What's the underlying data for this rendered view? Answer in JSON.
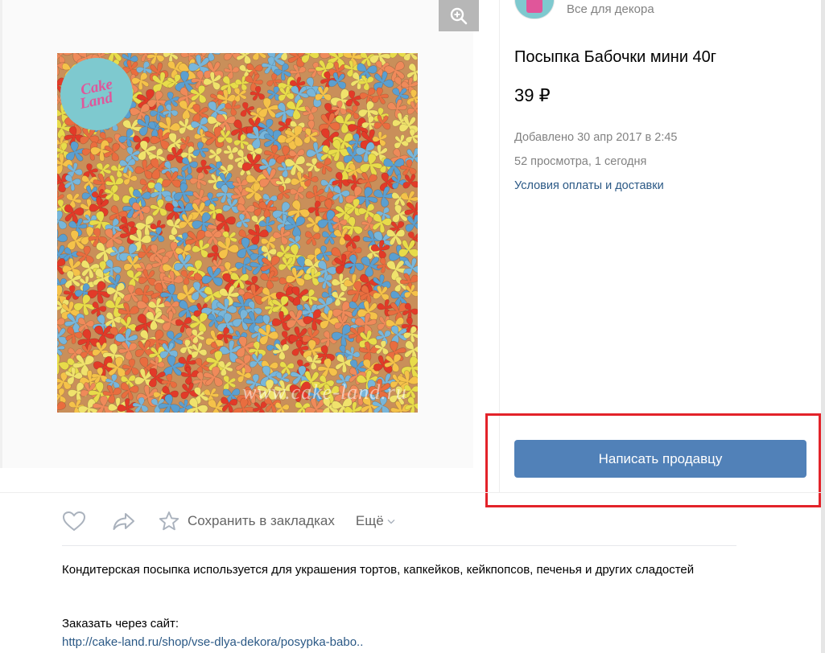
{
  "shop": {
    "name": "Все для декора",
    "avatar_icon": "cake-land-logo"
  },
  "product": {
    "title": "Посыпка Бабочки мини 40г",
    "price": "39 ₽",
    "added": "Добавлено 30 апр 2017 в 2:45",
    "views": "52 просмотра, 1 сегодня",
    "delivery_link": "Условия оплаты и доставки",
    "image": {
      "logo_line1": "Cake",
      "logo_line2": "Land",
      "watermark": "www.cake-land.ru",
      "colors": [
        "#e8dc4a",
        "#f0e26c",
        "#e23a28",
        "#ef8a5a",
        "#5b9fd0",
        "#78b6da",
        "#f5c24a",
        "#e96d3f"
      ]
    }
  },
  "contact_button": {
    "label": "Написать продавцу",
    "color": "#5181b8"
  },
  "highlight": {
    "color": "#e3232a"
  },
  "actions": {
    "like_icon": "heart-icon",
    "share_icon": "share-arrow-icon",
    "bookmark_icon": "star-icon",
    "bookmark_label": "Сохранить в закладках",
    "more_label": "Ещё"
  },
  "description": {
    "text": "Кондитерская посыпка используется для украшения тортов, капкейков, кейкпопсов, печенья и других сладостей",
    "order_label": "Заказать через сайт:",
    "order_link": "http://cake-land.ru/shop/vse-dlya-dekora/posypka-babo.."
  }
}
